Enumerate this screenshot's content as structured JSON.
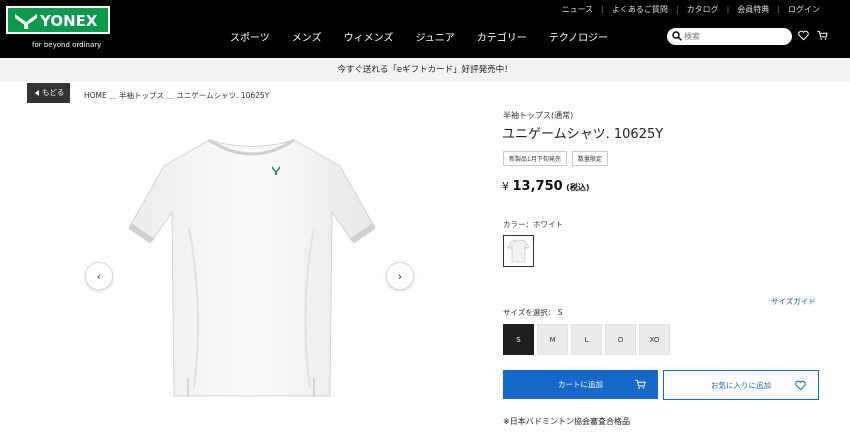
{
  "header": {
    "brand": "YONEX",
    "tagline": "for beyond ordinary",
    "utility_links": [
      "ニュース",
      "よくあるご質問",
      "カタログ",
      "会員特典",
      "ログイン"
    ],
    "main_nav": [
      "スポーツ",
      "メンズ",
      "ウィメンズ",
      "ジュニア",
      "カテゴリー",
      "テクノロジー"
    ],
    "search_placeholder": "検索"
  },
  "banner": {
    "text": "今すぐ送れる「eギフトカード」好評発売中！"
  },
  "breadcrumb": {
    "back_label": "もどる",
    "path": "HOME ＿ 半袖トップス ＿ ユニゲームシャツ. 10625Y"
  },
  "product": {
    "category": "半袖トップス(通常)",
    "title": "ユニゲームシャツ. 10625Y",
    "tags": [
      "新製品1月下旬発売",
      "数量限定"
    ],
    "price_symbol": "¥",
    "price": "13,750",
    "tax_note": "(税込)",
    "color_label": "カラー：ホワイト",
    "size_label": "サイズを選択：  S",
    "size_guide": "サイズガイド",
    "sizes": [
      "S",
      "M",
      "L",
      "O",
      "XO"
    ],
    "selected_size": "S",
    "add_to_cart": "カートに追加",
    "add_to_favorites": "お気に入りに追加",
    "certification_note": "※日本バドミントン協会審査合格品"
  },
  "colors": {
    "header_bg": "#000000",
    "brand_green": "#0a9a4b",
    "primary_blue": "#1668c9"
  }
}
